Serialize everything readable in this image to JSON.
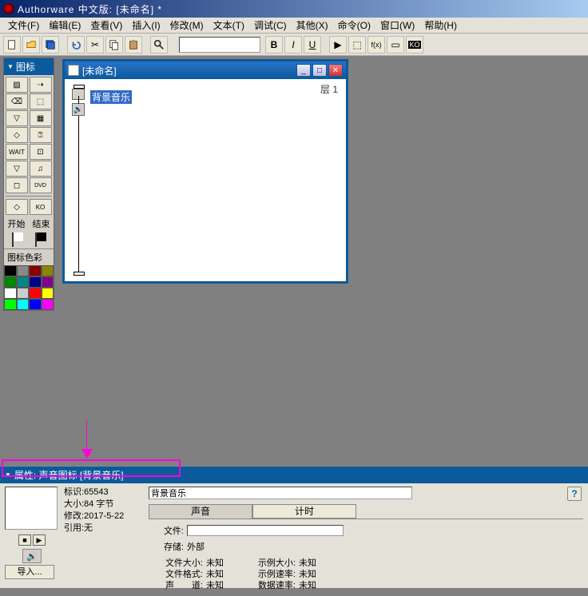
{
  "title": "Authorware 中文版: [未命名] *",
  "menu": [
    "文件(F)",
    "编辑(E)",
    "查看(V)",
    "插入(I)",
    "修改(M)",
    "文本(T)",
    "调试(C)",
    "其他(X)",
    "命令(O)",
    "窗口(W)",
    "帮助(H)"
  ],
  "palette": {
    "title": "图标",
    "start": "开始",
    "end": "结束",
    "color_title": "图标色彩"
  },
  "palette_colors": [
    "#000",
    "#888",
    "#800",
    "#880",
    "#080",
    "#088",
    "#008",
    "#808",
    "#fff",
    "#ccc",
    "#f00",
    "#ff0",
    "#0f0",
    "#0ff",
    "#00f",
    "#f0f"
  ],
  "design": {
    "title": "[未命名]",
    "level": "层  1",
    "node_label": "背景音乐"
  },
  "props": {
    "title": "属性: 声音图标 [背景音乐]",
    "id_label": "标识:65543",
    "size_label": "大小:84 字节",
    "mod_label": "修改:2017-5-22",
    "ref_label": "引用:无",
    "import": "导入...",
    "name_value": "背景音乐",
    "tab1": "声音",
    "tab2": "计时",
    "file_label": "文件:",
    "store_label": "存储:",
    "store_value": "外部",
    "d1l": "文件大小:",
    "d1v": "未知",
    "d2l": "文件格式:",
    "d2v": "未知",
    "d3l": "声　　道:",
    "d3v": "未知",
    "d4l": "示例大小:",
    "d4v": "未知",
    "d5l": "示例速率:",
    "d5v": "未知",
    "d6l": "数据速率:",
    "d6v": "未知"
  }
}
